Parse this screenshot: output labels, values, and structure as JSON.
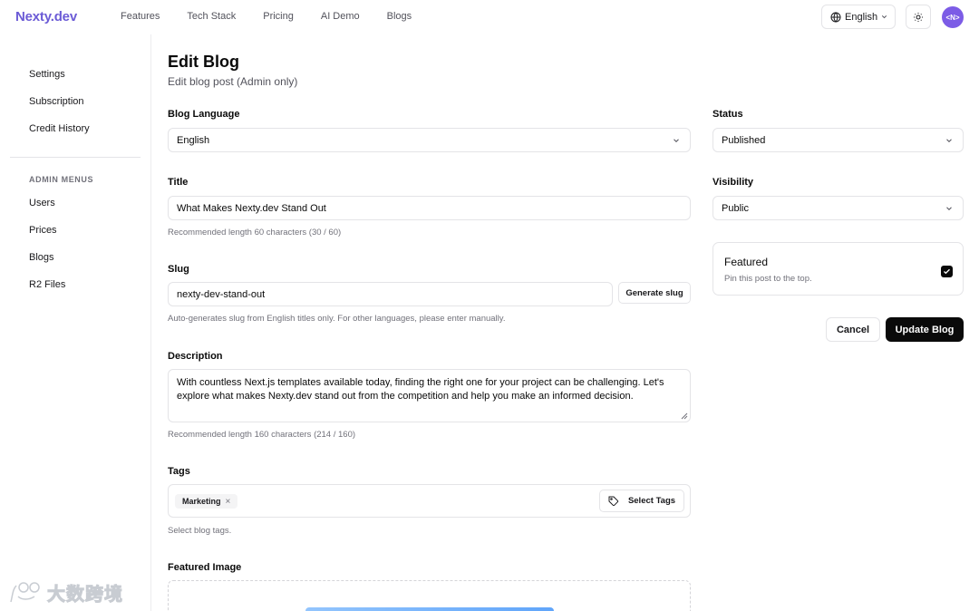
{
  "header": {
    "logo": "Nexty.dev",
    "nav": [
      "Features",
      "Tech Stack",
      "Pricing",
      "AI Demo",
      "Blogs"
    ],
    "language": "English",
    "avatar_text": "<N>"
  },
  "sidebar": {
    "items": [
      "Settings",
      "Subscription",
      "Credit History"
    ],
    "admin_heading": "ADMIN MENUS",
    "admin_items": [
      "Users",
      "Prices",
      "Blogs",
      "R2 Files"
    ]
  },
  "page": {
    "title": "Edit Blog",
    "subtitle": "Edit blog post (Admin only)"
  },
  "form": {
    "language_label": "Blog Language",
    "language_value": "English",
    "title_label": "Title",
    "title_value": "What Makes Nexty.dev Stand Out",
    "title_hint": "Recommended length 60 characters (30 / 60)",
    "slug_label": "Slug",
    "slug_value": "nexty-dev-stand-out",
    "generate_slug": "Generate slug",
    "slug_hint": "Auto-generates slug from English titles only. For other languages, please enter manually.",
    "description_label": "Description",
    "description_value": "With countless Next.js templates available today, finding the right one for your project can be challenging. Let's explore what makes Nexty.dev stand out from the competition and help you make an informed decision.",
    "description_hint": "Recommended length 160 characters (214 / 160)",
    "tags_label": "Tags",
    "tags": [
      "Marketing"
    ],
    "select_tags": "Select Tags",
    "tags_hint": "Select blog tags.",
    "featured_image_label": "Featured Image",
    "status_label": "Status",
    "status_value": "Published",
    "visibility_label": "Visibility",
    "visibility_value": "Public",
    "featured_title": "Featured",
    "featured_desc": "Pin this post to the top.",
    "featured_checked": true,
    "cancel": "Cancel",
    "submit": "Update Blog"
  },
  "colors": {
    "brand": "#6b5bd6",
    "primary_button": "#0a0a0a",
    "avatar": "#7c5ce6"
  },
  "watermark": "大数跨境"
}
